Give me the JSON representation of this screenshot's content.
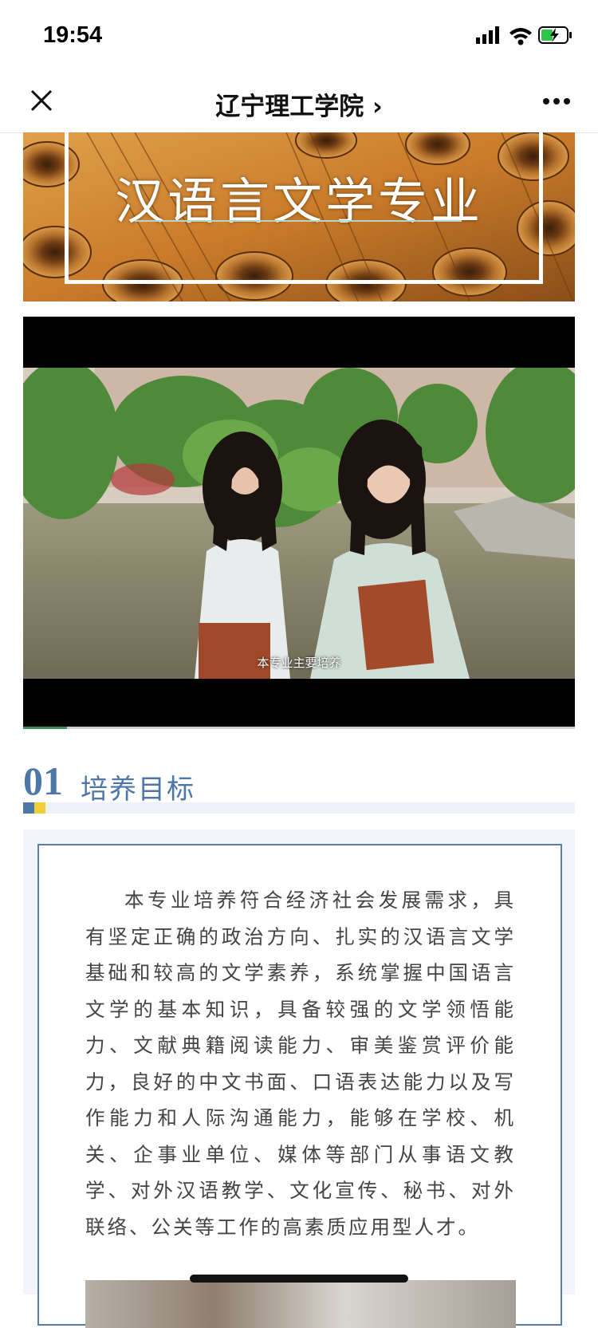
{
  "status_bar": {
    "time": "19:54",
    "icons": [
      "signal-icon",
      "wifi-icon",
      "battery-charging-icon"
    ]
  },
  "nav": {
    "title": "辽宁理工学院 ›",
    "close_icon": "close-icon",
    "more_icon": "more-icon"
  },
  "banner": {
    "title": "汉语言文学专业"
  },
  "video": {
    "subtitle": "本专业主要培养",
    "progress_fraction": 0.08
  },
  "section": {
    "number": "01",
    "title": "培养目标"
  },
  "content": {
    "paragraph": "本专业培养符合经济社会发展需求，具有坚定正确的政治方向、扎实的汉语言文学基础和较高的文学素养，系统掌握中国语言文学的基本知识，具备较强的文学领悟能力、文献典籍阅读能力、审美鉴赏评价能力，良好的中文书面、口语表达能力以及写作能力和人际沟通能力，能够在学校、机关、企事业单位、媒体等部门从事语文教学、对外汉语教学、文化宣传、秘书、对外联络、公关等工作的高素质应用型人才。"
  },
  "colors": {
    "accent_blue": "#4e77a8",
    "accent_yellow": "#f0cf3a"
  }
}
